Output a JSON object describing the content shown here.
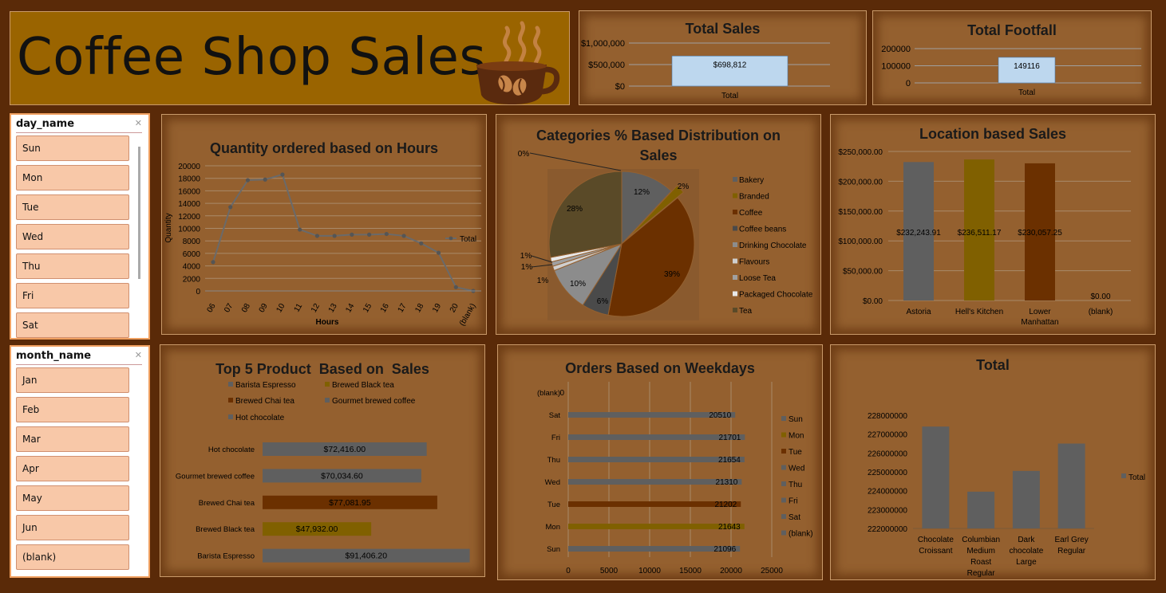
{
  "banner": {
    "title": "Coffee Shop Sales"
  },
  "slicers": {
    "day": {
      "title": "day_name",
      "items": [
        "Sun",
        "Mon",
        "Tue",
        "Wed",
        "Thu",
        "Fri",
        "Sat"
      ]
    },
    "month": {
      "title": "month_name",
      "items": [
        "Jan",
        "Feb",
        "Mar",
        "Apr",
        "May",
        "Jun",
        "(blank)"
      ]
    }
  },
  "colors": {
    "background": "#5a2a08",
    "panel": "#94602f",
    "grey": "#5f5f5f",
    "olive": "#806000",
    "brown": "#6b3000",
    "kpi_bar": "#bdd7ee",
    "slicer_item": "#f8c8a8"
  },
  "chart_data": [
    {
      "id": "total_sales",
      "type": "bar",
      "title": "Total Sales",
      "categories": [
        "Total"
      ],
      "values": [
        698812
      ],
      "data_labels": [
        "$698,812"
      ],
      "yticks": [
        "$0",
        "$500,000",
        "$1,000,000"
      ],
      "ylim": [
        0,
        1000000
      ]
    },
    {
      "id": "total_footfall",
      "type": "bar",
      "title": "Total Footfall",
      "categories": [
        "Total"
      ],
      "values": [
        149116
      ],
      "data_labels": [
        "149116"
      ],
      "yticks": [
        "0",
        "100000",
        "200000"
      ],
      "ylim": [
        0,
        200000
      ]
    },
    {
      "id": "hours",
      "type": "line",
      "title": "Quantity ordered based on Hours",
      "xlabel": "Hours",
      "ylabel": "Quantity",
      "categories": [
        "06",
        "07",
        "08",
        "09",
        "10",
        "11",
        "12",
        "13",
        "14",
        "15",
        "16",
        "17",
        "18",
        "19",
        "20",
        "(blank)"
      ],
      "values": [
        4600,
        13400,
        17700,
        17800,
        18600,
        9800,
        8800,
        8800,
        9000,
        9000,
        9100,
        8800,
        7600,
        6100,
        600,
        0
      ],
      "series_name": "Total",
      "ylim": [
        0,
        20000
      ],
      "yticks": [
        "0",
        "2000",
        "4000",
        "6000",
        "8000",
        "10000",
        "12000",
        "14000",
        "16000",
        "18000",
        "20000"
      ]
    },
    {
      "id": "categories",
      "type": "pie",
      "title": "Categories % Based Distribution on Sales",
      "categories": [
        "Bakery",
        "Branded",
        "Coffee",
        "Coffee beans",
        "Drinking Chocolate",
        "Flavours",
        "Loose Tea",
        "Packaged Chocolate",
        "Tea"
      ],
      "values": [
        12,
        2,
        39,
        6,
        10,
        1,
        1,
        1,
        28
      ],
      "data_labels": [
        "12%",
        "2%",
        "39%",
        "6%",
        "10%",
        "1%",
        "1%",
        "1%",
        "28%",
        "0%"
      ],
      "colors": [
        "#5f5f5f",
        "#806000",
        "#6b3000",
        "#4a4a4a",
        "#8c8c8c",
        "#cfcfcf",
        "#a0a0a0",
        "#e8e8e8",
        "#5a4a28"
      ]
    },
    {
      "id": "location",
      "type": "bar",
      "title": "Location based Sales",
      "categories": [
        "Astoria",
        "Hell's Kitchen",
        "Lower Manhattan",
        "(blank)"
      ],
      "values": [
        232243.91,
        236511.17,
        230057.25,
        0
      ],
      "data_labels": [
        "$232,243.91",
        "$236,511.17",
        "$230,057.25",
        "$0.00"
      ],
      "yticks": [
        "$0.00",
        "$50,000.00",
        "$100,000.00",
        "$150,000.00",
        "$200,000.00",
        "$250,000.00"
      ],
      "ylim": [
        0,
        250000
      ]
    },
    {
      "id": "top5",
      "type": "bar",
      "orientation": "horizontal",
      "title": "Top 5 Product  Based on  Sales",
      "categories": [
        "Hot chocolate",
        "Gourmet brewed coffee",
        "Brewed Chai tea",
        "Brewed Black tea",
        "Barista Espresso"
      ],
      "values": [
        72416.0,
        70034.6,
        77081.95,
        47932.0,
        91406.2
      ],
      "data_labels": [
        "$72,416.00",
        "$70,034.60",
        "$77,081.95",
        "$47,932.00",
        "$91,406.20"
      ],
      "legend": [
        "Barista Espresso",
        "Brewed Black tea",
        "Brewed Chai tea",
        "Gourmet brewed coffee",
        "Hot chocolate"
      ],
      "xlim": [
        0,
        100000
      ]
    },
    {
      "id": "weekdays",
      "type": "bar",
      "orientation": "horizontal",
      "title": "Orders Based on Weekdays",
      "categories": [
        "(blank)",
        "Sat",
        "Fri",
        "Thu",
        "Wed",
        "Tue",
        "Mon",
        "Sun"
      ],
      "values": [
        0,
        20510,
        21701,
        21654,
        21310,
        21202,
        21643,
        21096
      ],
      "data_labels": [
        "0",
        "20510",
        "21701",
        "21654",
        "21310",
        "21202",
        "21643",
        "21096"
      ],
      "legend": [
        "Sun",
        "Mon",
        "Tue",
        "Wed",
        "Thu",
        "Fri",
        "Sat",
        "(blank)"
      ],
      "xticks": [
        "0",
        "5000",
        "10000",
        "15000",
        "20000",
        "25000"
      ],
      "xlim": [
        0,
        25000
      ]
    },
    {
      "id": "total_products",
      "type": "bar",
      "title": "Total",
      "categories": [
        "Chocolate Croissant",
        "Columbian Medium Roast Regular",
        "Dark chocolate Large",
        "Earl Grey Regular"
      ],
      "values": [
        227400000,
        223950000,
        225050000,
        226500000
      ],
      "series_name": "Total",
      "ylim": [
        222000000,
        228000000
      ],
      "yticks": [
        "222000000",
        "223000000",
        "224000000",
        "225000000",
        "226000000",
        "227000000",
        "228000000"
      ]
    }
  ]
}
